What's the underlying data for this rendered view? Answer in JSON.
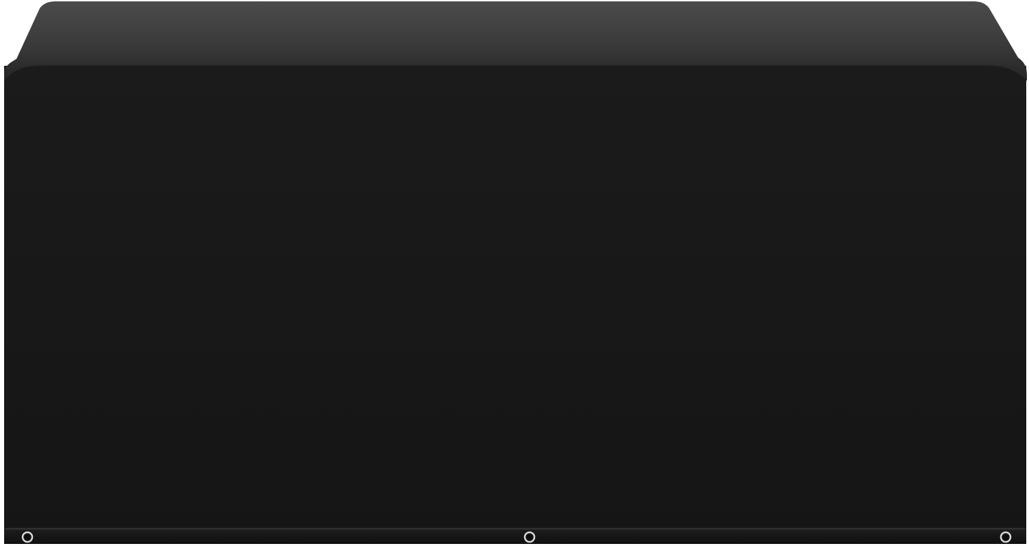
{
  "image": {
    "subject": "black-rectangular-furniture-cover",
    "colors": {
      "background": "#ffffff",
      "cover_top_light": "#4a4a4a",
      "cover_top_dark": "#2b2b2b",
      "cover_front": "#181818",
      "hem": "#141414",
      "grommet_ring": "#d8d8d8",
      "grommet_hole": "#0c0c0c"
    },
    "grommet_count": 3
  }
}
